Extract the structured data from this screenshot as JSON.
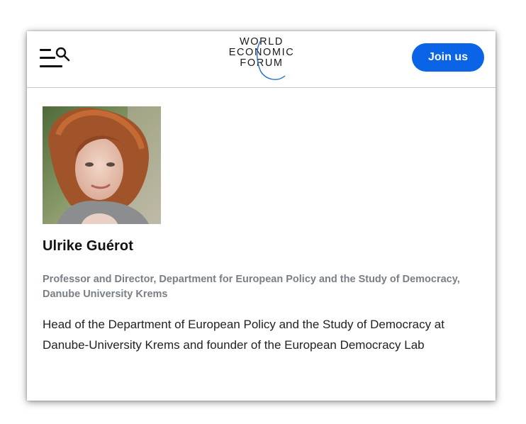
{
  "header": {
    "menu_icon": "menu-search-icon",
    "logo": {
      "line1": "WORLD",
      "line2": "ECONOMIC",
      "line3": "FORUM"
    },
    "join_label": "Join us",
    "accent_color": "#0b63e6"
  },
  "profile": {
    "avatar_icon": "profile-photo",
    "name": "Ulrike Guérot",
    "title": "Professor and Director, Department for European Policy and the Study of Democracy, Danube University Krems",
    "bio": "Head of the Department of European Policy and the Study of Democracy at Danube-University Krems and founder of the European Democracy Lab"
  }
}
